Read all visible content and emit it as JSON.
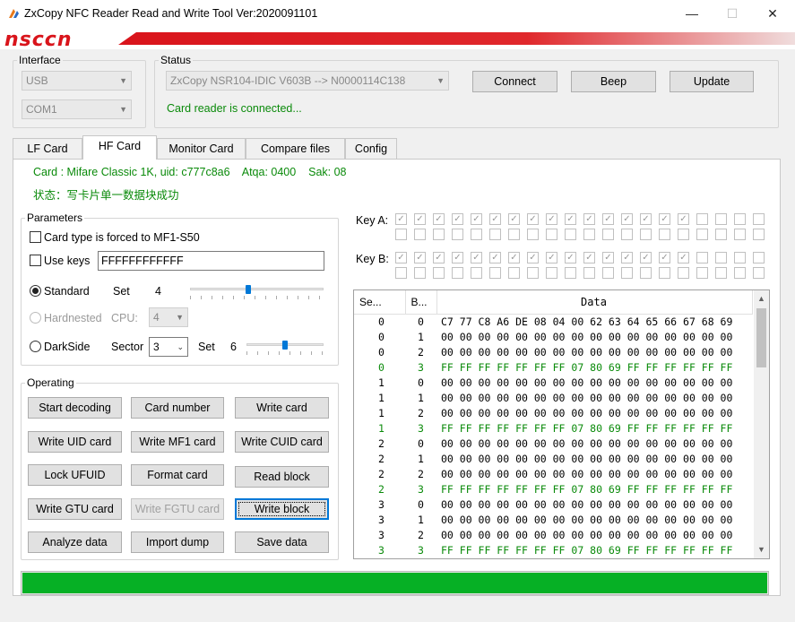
{
  "window": {
    "title": "ZxCopy NFC Reader Read and Write Tool  Ver:2020091101",
    "minimize": "—",
    "maximize": "☐",
    "close": "✕"
  },
  "banner": {
    "logo": "nsccn"
  },
  "interface": {
    "legend": "Interface",
    "port_type": "USB",
    "port": "COM1"
  },
  "status": {
    "legend": "Status",
    "device": "ZxCopy NSR104-IDIC V603B --> N0000114C138",
    "message": "Card reader is connected...",
    "connect": "Connect",
    "beep": "Beep",
    "update": "Update"
  },
  "tabs": [
    {
      "label": "LF Card"
    },
    {
      "label": "HF Card"
    },
    {
      "label": "Monitor Card"
    },
    {
      "label": "Compare files"
    },
    {
      "label": "Config"
    }
  ],
  "card_info": {
    "line1": "Card : Mifare Classic 1K, uid: c777c8a6    Atqa: 0400    Sak: 08",
    "line2": "状态：写卡片单一数据块成功"
  },
  "parameters": {
    "legend": "Parameters",
    "force_type_label": "Card type is forced to MF1-S50",
    "use_keys_label": "Use keys",
    "keys_value": "FFFFFFFFFFFF",
    "standard_label": "Standard",
    "standard_set_label": "Set",
    "standard_set_value": "4",
    "standard_slider_level": 0.55,
    "hardnested_label": "Hardnested",
    "cpu_label": "CPU:",
    "cpu_value": "4",
    "darkside_label": "DarkSide",
    "sector_label": "Sector",
    "sector_value": "3",
    "darkside_set_label": "Set",
    "darkside_set_value": "6",
    "darkside_slider_level": 0.5
  },
  "operating": {
    "legend": "Operating",
    "buttons": [
      "Start decoding",
      "Card number",
      "Write card",
      "Write UID card",
      "Write MF1 card",
      "Write CUID card",
      "Lock UFUID",
      "Format card",
      "Read block",
      "Write GTU card",
      "Write FGTU card",
      "Write block",
      "Analyze data",
      "Import dump",
      "Save data"
    ]
  },
  "keys": {
    "key_a_label": "Key A:",
    "key_b_label": "Key B:",
    "key_a_checked": [
      1,
      1,
      1,
      1,
      1,
      1,
      1,
      1,
      1,
      1,
      1,
      1,
      1,
      1,
      1,
      1,
      0,
      0,
      0,
      0,
      0,
      0,
      0,
      0,
      0,
      0,
      0,
      0,
      0,
      0,
      0,
      0,
      0,
      0,
      0,
      0,
      0,
      0,
      0,
      0
    ],
    "key_b_checked": [
      1,
      1,
      1,
      1,
      1,
      1,
      1,
      1,
      1,
      1,
      1,
      1,
      1,
      1,
      1,
      1,
      0,
      0,
      0,
      0,
      0,
      0,
      0,
      0,
      0,
      0,
      0,
      0,
      0,
      0,
      0,
      0,
      0,
      0,
      0,
      0,
      0,
      0,
      0,
      0
    ]
  },
  "grid": {
    "headers": [
      "Se...",
      "B...",
      "Data"
    ],
    "rows": [
      [
        "0",
        "0",
        "C7 77 C8 A6 DE 08 04 00 62 63 64 65 66 67 68 69"
      ],
      [
        "0",
        "1",
        "00 00 00 00 00 00 00 00 00 00 00 00 00 00 00 00"
      ],
      [
        "0",
        "2",
        "00 00 00 00 00 00 00 00 00 00 00 00 00 00 00 00"
      ],
      [
        "0",
        "3",
        "FF FF FF FF FF FF FF 07 80 69 FF FF FF FF FF FF"
      ],
      [
        "1",
        "0",
        "00 00 00 00 00 00 00 00 00 00 00 00 00 00 00 00"
      ],
      [
        "1",
        "1",
        "00 00 00 00 00 00 00 00 00 00 00 00 00 00 00 00"
      ],
      [
        "1",
        "2",
        "00 00 00 00 00 00 00 00 00 00 00 00 00 00 00 00"
      ],
      [
        "1",
        "3",
        "FF FF FF FF FF FF FF 07 80 69 FF FF FF FF FF FF"
      ],
      [
        "2",
        "0",
        "00 00 00 00 00 00 00 00 00 00 00 00 00 00 00 00"
      ],
      [
        "2",
        "1",
        "00 00 00 00 00 00 00 00 00 00 00 00 00 00 00 00"
      ],
      [
        "2",
        "2",
        "00 00 00 00 00 00 00 00 00 00 00 00 00 00 00 00"
      ],
      [
        "2",
        "3",
        "FF FF FF FF FF FF FF 07 80 69 FF FF FF FF FF FF"
      ],
      [
        "3",
        "0",
        "00 00 00 00 00 00 00 00 00 00 00 00 00 00 00 00"
      ],
      [
        "3",
        "1",
        "00 00 00 00 00 00 00 00 00 00 00 00 00 00 00 00"
      ],
      [
        "3",
        "2",
        "00 00 00 00 00 00 00 00 00 00 00 00 00 00 00 00"
      ],
      [
        "3",
        "3",
        "FF FF FF FF FF FF FF 07 80 69 FF FF FF FF FF FF"
      ]
    ]
  },
  "progress": {
    "fraction": 1.0
  },
  "colors": {
    "accent": "#0078d7",
    "progress": "#06b025",
    "status_green": "#0a8a0a",
    "brand_red": "#d9141b"
  }
}
